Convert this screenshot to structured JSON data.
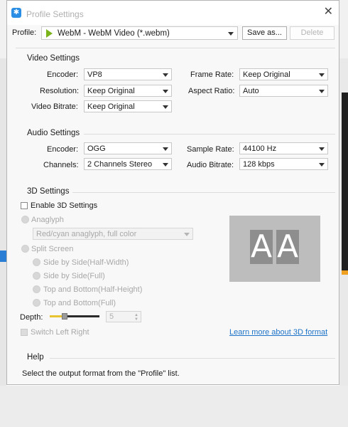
{
  "window": {
    "title": "Profile Settings",
    "close_glyph": "✕"
  },
  "profile": {
    "label": "Profile:",
    "value": "WebM - WebM Video (*.webm)",
    "icon": "webm-play-icon",
    "save_as_label": "Save as...",
    "delete_label": "Delete"
  },
  "video": {
    "title": "Video Settings",
    "encoder_label": "Encoder:",
    "encoder_value": "VP8",
    "resolution_label": "Resolution:",
    "resolution_value": "Keep Original",
    "bitrate_label": "Video Bitrate:",
    "bitrate_value": "Keep Original",
    "framerate_label": "Frame Rate:",
    "framerate_value": "Keep Original",
    "aspect_label": "Aspect Ratio:",
    "aspect_value": "Auto"
  },
  "audio": {
    "title": "Audio Settings",
    "encoder_label": "Encoder:",
    "encoder_value": "OGG",
    "channels_label": "Channels:",
    "channels_value": "2 Channels Stereo",
    "samplerate_label": "Sample Rate:",
    "samplerate_value": "44100 Hz",
    "bitrate_label": "Audio Bitrate:",
    "bitrate_value": "128 kbps"
  },
  "three_d": {
    "title": "3D Settings",
    "enable_label": "Enable 3D Settings",
    "enabled": false,
    "anaglyph_label": "Anaglyph",
    "anaglyph_value": "Red/cyan anaglyph, full color",
    "split_label": "Split Screen",
    "split_options": [
      "Side by Side(Half-Width)",
      "Side by Side(Full)",
      "Top and Bottom(Half-Height)",
      "Top and Bottom(Full)"
    ],
    "depth_label": "Depth:",
    "depth_value": "5",
    "depth_level": 0.3,
    "switch_label": "Switch Left Right",
    "preview_left": "A",
    "preview_right": "A",
    "learn_more": "Learn more about 3D format"
  },
  "help": {
    "title": "Help",
    "text": "Select the output format from the \"Profile\" list."
  },
  "colors": {
    "accent": "#2a8ee4",
    "link": "#1e73c8",
    "slider_fill": "#e8c530"
  }
}
